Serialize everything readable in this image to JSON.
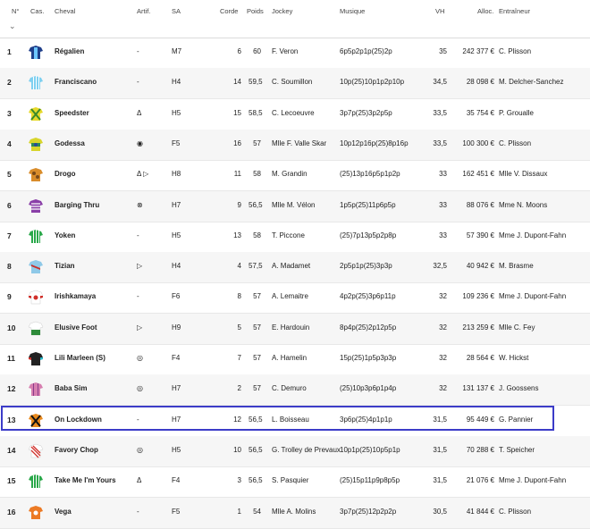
{
  "columns": {
    "num": "N°",
    "cas": "Cas.",
    "cheval": "Cheval",
    "artif": "Artif.",
    "sa": "SA",
    "corde": "Corde",
    "poids": "Poids",
    "jockey": "Jockey",
    "musique": "Musique",
    "vh": "VH",
    "alloc": "Alloc.",
    "trainer": "Entraîneur"
  },
  "colors": {
    "selected_border": "#3c3cc8",
    "alt_row": "#f6f6f6"
  },
  "rows": [
    {
      "num": "1",
      "horse": "Régalien",
      "artif": "-",
      "sa": "M7",
      "corde": "6",
      "poids": "60",
      "jockey": "F. Veron",
      "musique": "6p5p2p1p(25)2p",
      "vh": "35",
      "alloc": "242 377 €",
      "trainer": "C. Plisson",
      "silk": "dark-blue-light-blue"
    },
    {
      "num": "2",
      "horse": "Franciscano",
      "artif": "-",
      "sa": "H4",
      "corde": "14",
      "poids": "59,5",
      "jockey": "C. Soumillon",
      "musique": "10p(25)10p1p2p10p",
      "vh": "34,5",
      "alloc": "28 098 €",
      "trainer": "M. Delcher-Sanchez",
      "silk": "light-blue-white-stripes"
    },
    {
      "num": "3",
      "horse": "Speedster",
      "artif": "Δ",
      "sa": "H5",
      "corde": "15",
      "poids": "58,5",
      "jockey": "C. Lecoeuvre",
      "musique": "3p7p(25)3p2p5p",
      "vh": "33,5",
      "alloc": "35 754 €",
      "trainer": "P. Groualle",
      "silk": "yellow-green-cross"
    },
    {
      "num": "4",
      "horse": "Godessa",
      "artif": "◉",
      "sa": "F5",
      "corde": "16",
      "poids": "57",
      "jockey": "Mlle F. Valle Skar",
      "musique": "10p12p16p(25)8p16p",
      "vh": "33,5",
      "alloc": "100 300 €",
      "trainer": "C. Plisson",
      "silk": "yellow-green-blue"
    },
    {
      "num": "5",
      "horse": "Drogo",
      "artif": "Δ ▷",
      "sa": "H8",
      "corde": "11",
      "poids": "58",
      "jockey": "M. Grandin",
      "musique": "(25)13p16p5p1p2p",
      "vh": "33",
      "alloc": "162 451 €",
      "trainer": "Mlle V. Dissaux",
      "silk": "orange-brown"
    },
    {
      "num": "6",
      "horse": "Barging Thru",
      "artif": "⊗",
      "sa": "H7",
      "corde": "9",
      "poids": "56,5",
      "jockey": "Mlle M. Vélon",
      "musique": "1p5p(25)11p6p5p",
      "vh": "33",
      "alloc": "88 076 €",
      "trainer": "Mme N. Moons",
      "silk": "purple-white-stripes"
    },
    {
      "num": "7",
      "horse": "Yoken",
      "artif": "-",
      "sa": "H5",
      "corde": "13",
      "poids": "58",
      "jockey": "T. Piccone",
      "musique": "(25)7p13p5p2p8p",
      "vh": "33",
      "alloc": "57 390 €",
      "trainer": "Mme J. Dupont-Fahn",
      "silk": "green-white-stripes"
    },
    {
      "num": "8",
      "horse": "Tizian",
      "artif": "▷",
      "sa": "H4",
      "corde": "4",
      "poids": "57,5",
      "jockey": "A. Madamet",
      "musique": "2p5p1p(25)3p3p",
      "vh": "32,5",
      "alloc": "40 942 €",
      "trainer": "M. Brasme",
      "silk": "light-blue-red"
    },
    {
      "num": "9",
      "horse": "Irishkamaya",
      "artif": "-",
      "sa": "F6",
      "corde": "8",
      "poids": "57",
      "jockey": "A. Lemaitre",
      "musique": "4p2p(25)3p6p11p",
      "vh": "32",
      "alloc": "109 236 €",
      "trainer": "Mme J. Dupont-Fahn",
      "silk": "red-white"
    },
    {
      "num": "10",
      "horse": "Elusive Foot",
      "artif": "▷",
      "sa": "H9",
      "corde": "5",
      "poids": "57",
      "jockey": "E. Hardouin",
      "musique": "8p4p(25)2p12p5p",
      "vh": "32",
      "alloc": "213 259 €",
      "trainer": "Mlle C. Fey",
      "silk": "white-green"
    },
    {
      "num": "11",
      "horse": "Lili Marleen (S)",
      "artif": "◎",
      "sa": "F4",
      "corde": "7",
      "poids": "57",
      "jockey": "A. Hamelin",
      "musique": "15p(25)1p5p3p3p",
      "vh": "32",
      "alloc": "28 564 €",
      "trainer": "W. Hickst",
      "silk": "black-cyan-red"
    },
    {
      "num": "12",
      "horse": "Baba Sim",
      "artif": "◎",
      "sa": "H7",
      "corde": "2",
      "poids": "57",
      "jockey": "C. Demuro",
      "musique": "(25)10p3p6p1p4p",
      "vh": "32",
      "alloc": "131 137 €",
      "trainer": "J. Goossens",
      "silk": "pink-purple"
    },
    {
      "num": "13",
      "horse": "On Lockdown",
      "artif": "-",
      "sa": "H7",
      "corde": "12",
      "poids": "56,5",
      "jockey": "L. Boisseau",
      "musique": "3p6p(25)4p1p1p",
      "vh": "31,5",
      "alloc": "95 449 €",
      "trainer": "G. Pannier",
      "silk": "orange-black"
    },
    {
      "num": "14",
      "horse": "Favory Chop",
      "artif": "◎",
      "sa": "H5",
      "corde": "10",
      "poids": "56,5",
      "jockey": "G. Trolley de Prevaux",
      "musique": "10p1p(25)10p5p1p",
      "vh": "31,5",
      "alloc": "70 288 €",
      "trainer": "T. Speicher",
      "silk": "red-white-stripes"
    },
    {
      "num": "15",
      "horse": "Take Me I'm Yours",
      "artif": "Δ",
      "sa": "F4",
      "corde": "3",
      "poids": "56,5",
      "jockey": "S. Pasquier",
      "musique": "(25)15p11p9p8p5p",
      "vh": "31,5",
      "alloc": "21 076 €",
      "trainer": "Mme J. Dupont-Fahn",
      "silk": "green-white-stripes"
    },
    {
      "num": "16",
      "horse": "Vega",
      "artif": "-",
      "sa": "F5",
      "corde": "1",
      "poids": "54",
      "jockey": "Mlle A. Molins",
      "musique": "3p7p(25)12p2p2p",
      "vh": "30,5",
      "alloc": "41 844 €",
      "trainer": "C. Plisson",
      "silk": "orange-white"
    }
  ]
}
